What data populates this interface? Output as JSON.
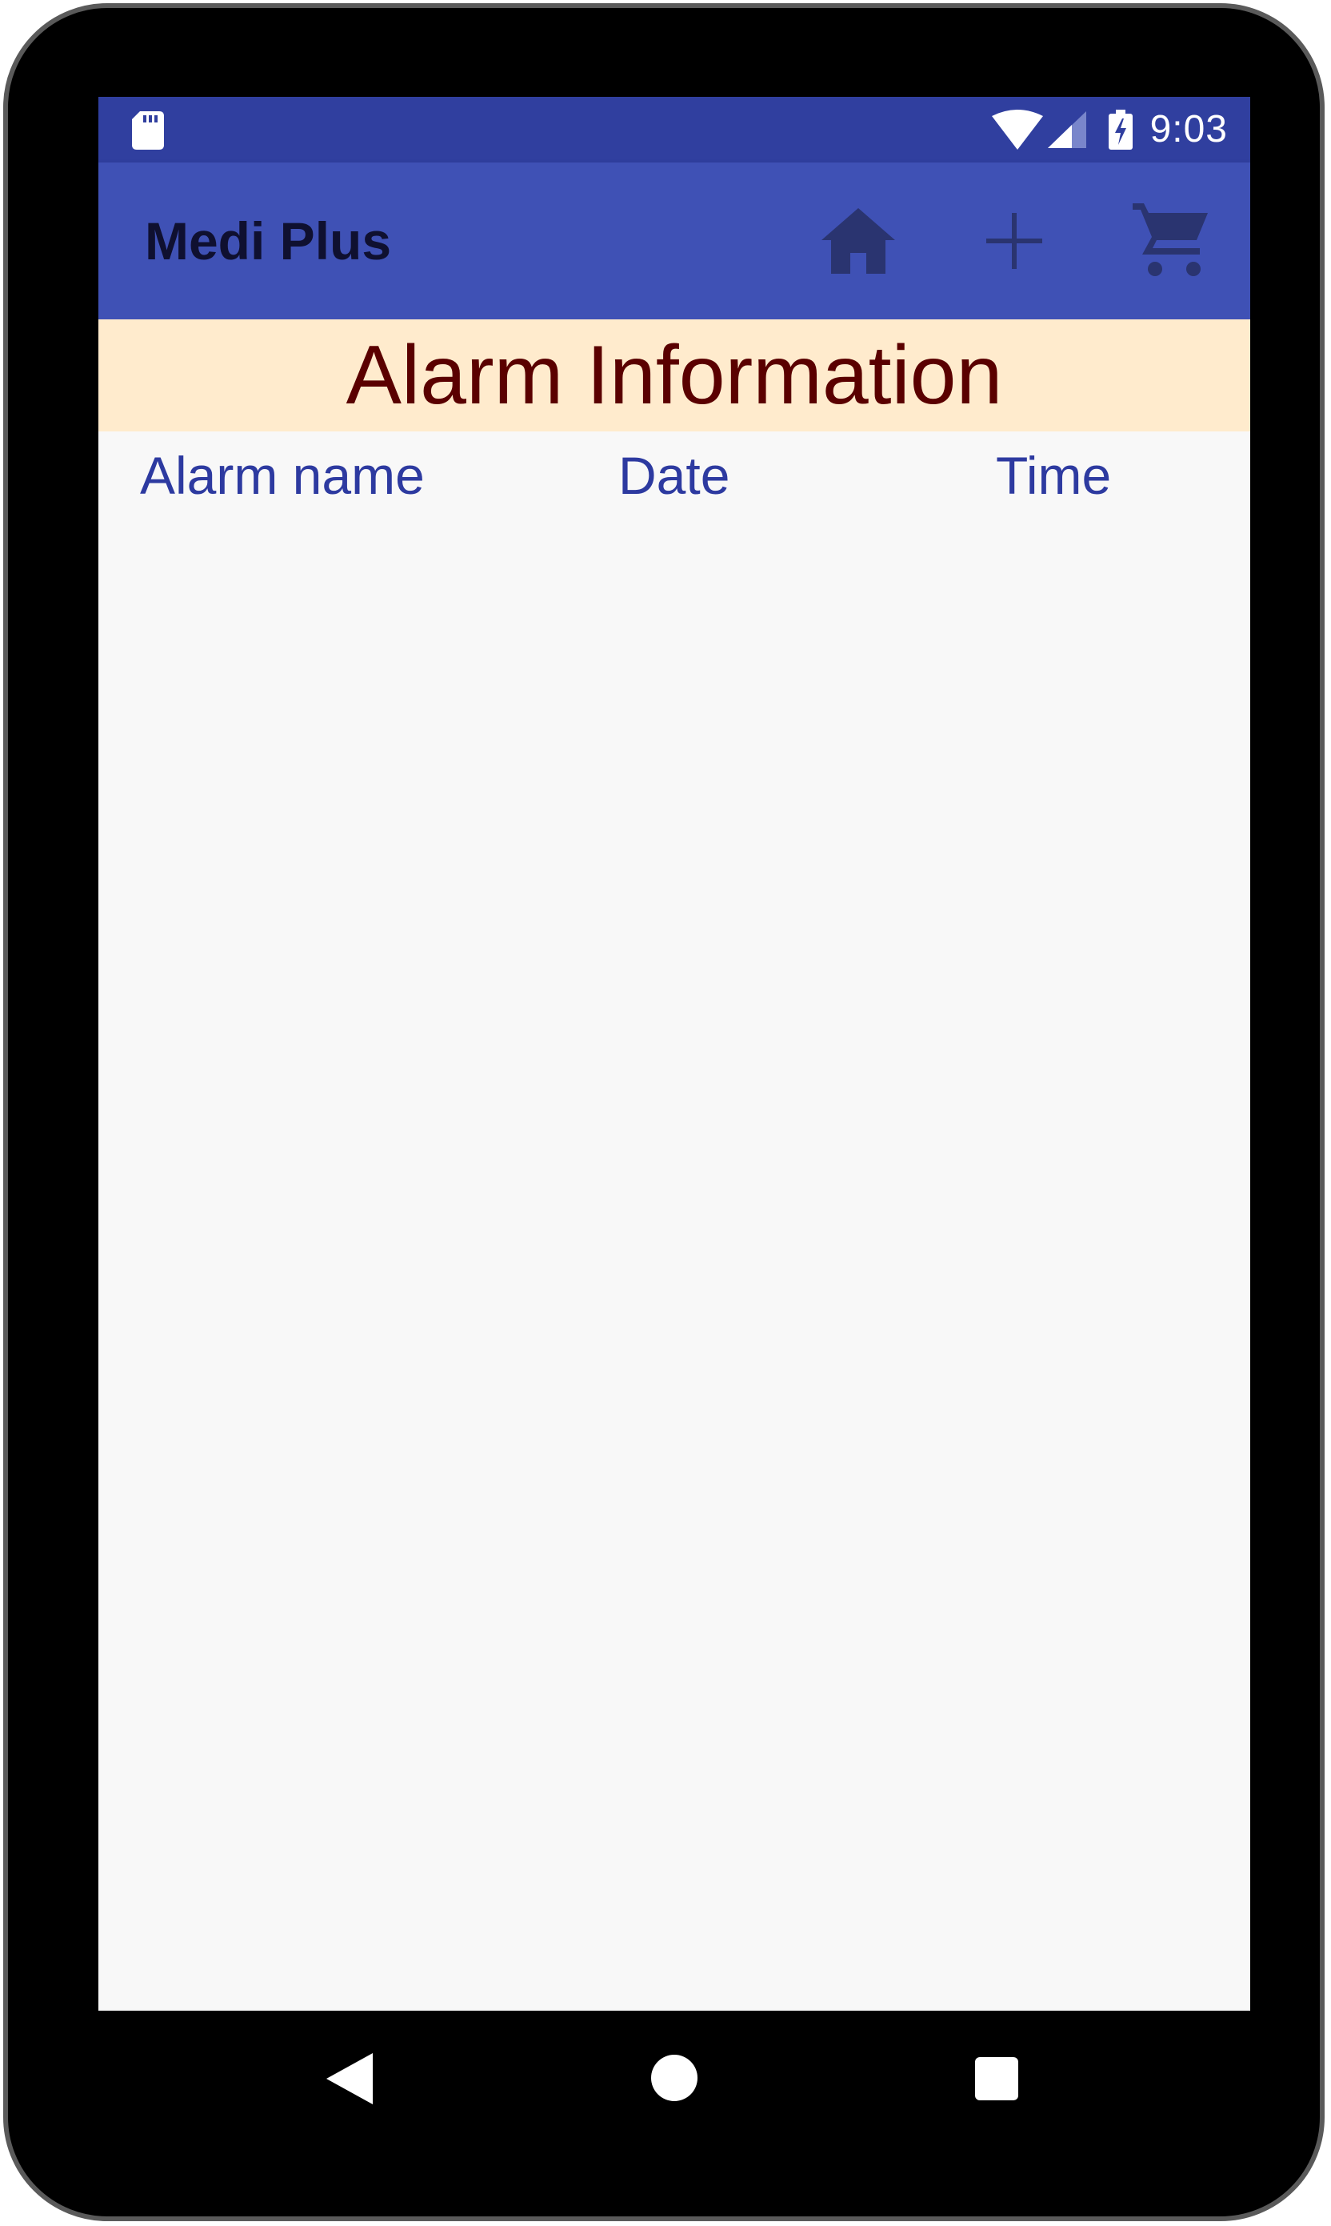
{
  "status_bar": {
    "time": "9:03",
    "icons": [
      "sd-card-icon",
      "wifi-icon",
      "signal-icon",
      "battery-charging-icon"
    ]
  },
  "app_bar": {
    "title": "Medi Plus",
    "actions": [
      "home-icon",
      "add-icon",
      "cart-icon"
    ]
  },
  "banner": {
    "title": "Alarm Information"
  },
  "table": {
    "columns": [
      "Alarm name",
      "Date",
      "Time"
    ],
    "rows": []
  },
  "nav_bar": {
    "buttons": [
      "back-icon",
      "home-circle-icon",
      "recents-icon"
    ]
  },
  "colors": {
    "status_bar": "#303f9f",
    "app_bar": "#3f51b5",
    "banner_bg": "#ffebcd",
    "banner_text": "#5a0000",
    "column_header_text": "#2d3aa0",
    "screen_bg": "#f8f8f8"
  }
}
